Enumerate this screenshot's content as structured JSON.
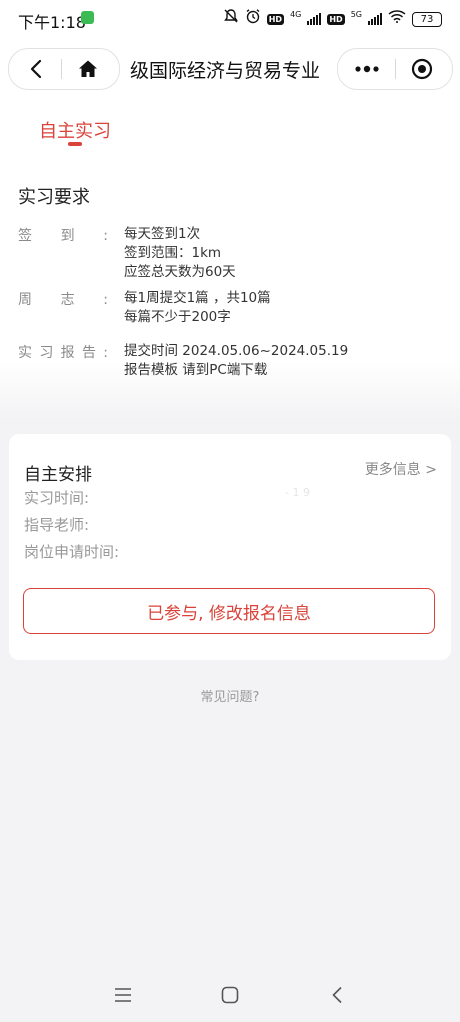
{
  "status_bar": {
    "time": "下午1:18",
    "network_left": "4G",
    "network_right": "5G",
    "hd_label": "HD",
    "battery": "73",
    "icons": [
      "app-notification-icon",
      "mute-bell-icon",
      "alarm-icon",
      "signal-icon",
      "wifi-icon",
      "battery-icon"
    ]
  },
  "nav": {
    "title": "级国际经济与贸易专业",
    "icons": [
      "back-icon",
      "home-icon",
      "more-dots-icon",
      "target-circle-icon"
    ]
  },
  "tabs": [
    {
      "label": "自主实习",
      "active": true
    }
  ],
  "requirements": {
    "title": "实习要求",
    "rows": [
      {
        "label": "签到:",
        "lines": [
          "每天签到1次",
          "签到范围：1km",
          "应签总天数为60天"
        ]
      },
      {
        "label": "周志:",
        "lines": [
          "每1周提交1篇 ，共10篇",
          "每篇不少于200字"
        ]
      },
      {
        "label": "实习报告:",
        "lines": [
          "提交时间 2024.05.06~2024.05.19",
          "报告模板 请到PC端下载"
        ]
      }
    ]
  },
  "card": {
    "title": "自主安排",
    "more_link": "更多信息 >",
    "fields": [
      {
        "label": "实习时间:"
      },
      {
        "label": "指导老师:"
      },
      {
        "label": "岗位申请时间:"
      }
    ],
    "faint_value": "- 1 9",
    "button_label": "已参与, 修改报名信息"
  },
  "faq_link": "常见问题?",
  "bottom_nav": {
    "icons": [
      "menu-icon",
      "home-square-icon",
      "back-chevron-icon"
    ]
  },
  "colors": {
    "accent": "#d9433a",
    "background": "#f3f3f5",
    "card": "#ffffff",
    "muted_text": "#999999"
  }
}
